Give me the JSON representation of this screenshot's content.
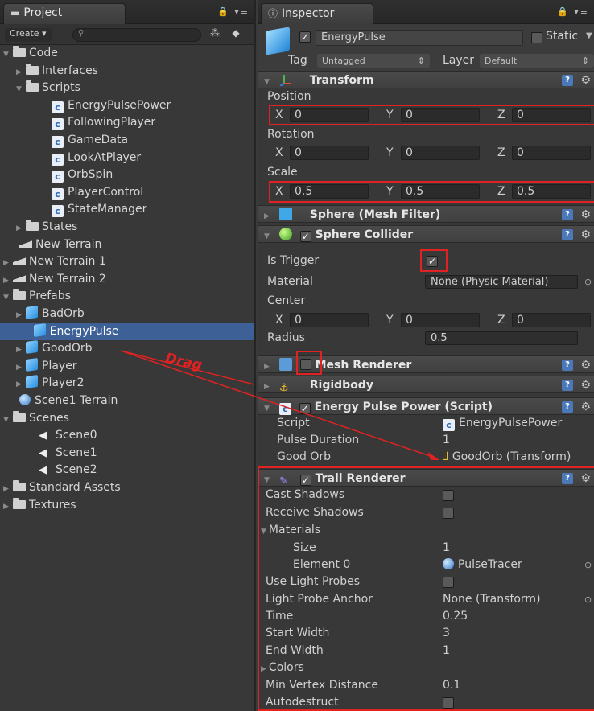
{
  "project": {
    "tab_label": "Project",
    "create_label": "Create ▾",
    "tree": [
      {
        "label": "Code",
        "icon": "folder-icon",
        "arrow": "▼",
        "indent": 0
      },
      {
        "label": "Interfaces",
        "icon": "folder-icon",
        "arrow": "▶",
        "indent": 1
      },
      {
        "label": "Scripts",
        "icon": "folder-icon",
        "arrow": "▼",
        "indent": 1
      },
      {
        "label": "EnergyPulsePower",
        "icon": "csharp-script-icon",
        "arrow": "",
        "indent": 3
      },
      {
        "label": "FollowingPlayer",
        "icon": "csharp-script-icon",
        "arrow": "",
        "indent": 3
      },
      {
        "label": "GameData",
        "icon": "csharp-script-icon",
        "arrow": "",
        "indent": 3
      },
      {
        "label": "LookAtPlayer",
        "icon": "csharp-script-icon",
        "arrow": "",
        "indent": 3
      },
      {
        "label": "OrbSpin",
        "icon": "csharp-script-icon",
        "arrow": "",
        "indent": 3
      },
      {
        "label": "PlayerControl",
        "icon": "csharp-script-icon",
        "arrow": "",
        "indent": 3
      },
      {
        "label": "StateManager",
        "icon": "csharp-script-icon",
        "arrow": "",
        "indent": 3
      },
      {
        "label": "States",
        "icon": "folder-icon",
        "arrow": "▶",
        "indent": 1
      },
      {
        "label": "New Terrain",
        "icon": "terrain-icon",
        "arrow": "",
        "indent": 0.5
      },
      {
        "label": "New Terrain 1",
        "icon": "terrain-icon",
        "arrow": "▶",
        "indent": 0
      },
      {
        "label": "New Terrain 2",
        "icon": "terrain-icon",
        "arrow": "▶",
        "indent": 0
      },
      {
        "label": "Prefabs",
        "icon": "folder-icon",
        "arrow": "▼",
        "indent": 0
      },
      {
        "label": "BadOrb",
        "icon": "prefab-cube-icon",
        "arrow": "▶",
        "indent": 1
      },
      {
        "label": "EnergyPulse",
        "icon": "prefab-cube-icon",
        "arrow": "",
        "indent": 1.6,
        "selected": true
      },
      {
        "label": "GoodOrb",
        "icon": "prefab-cube-icon",
        "arrow": "▶",
        "indent": 1
      },
      {
        "label": "Player",
        "icon": "prefab-cube-icon",
        "arrow": "▶",
        "indent": 1
      },
      {
        "label": "Player2",
        "icon": "prefab-cube-icon",
        "arrow": "▶",
        "indent": 1
      },
      {
        "label": "Scene1 Terrain",
        "icon": "terrain-sphere-icon",
        "arrow": "",
        "indent": 0.5
      },
      {
        "label": "Scenes",
        "icon": "folder-icon",
        "arrow": "▼",
        "indent": 0
      },
      {
        "label": "Scene0",
        "icon": "unity-scene-icon",
        "arrow": "",
        "indent": 2
      },
      {
        "label": "Scene1",
        "icon": "unity-scene-icon",
        "arrow": "",
        "indent": 2
      },
      {
        "label": "Scene2",
        "icon": "unity-scene-icon",
        "arrow": "",
        "indent": 2
      },
      {
        "label": "Standard Assets",
        "icon": "folder-icon",
        "arrow": "▶",
        "indent": 0
      },
      {
        "label": "Textures",
        "icon": "folder-icon",
        "arrow": "▶",
        "indent": 0
      }
    ]
  },
  "inspector": {
    "tab_label": "Inspector",
    "object_name": "EnergyPulse",
    "static_label": "Static",
    "tag_label": "Tag",
    "tag_value": "Untagged",
    "layer_label": "Layer",
    "layer_value": "Default",
    "transform": {
      "title": "Transform",
      "position_label": "Position",
      "position": {
        "x": "0",
        "y": "0",
        "z": "0"
      },
      "rotation_label": "Rotation",
      "rotation": {
        "x": "0",
        "y": "0",
        "z": "0"
      },
      "scale_label": "Scale",
      "scale": {
        "x": "0.5",
        "y": "0.5",
        "z": "0.5"
      }
    },
    "mesh_filter": {
      "title": "Sphere (Mesh Filter)"
    },
    "sphere_collider": {
      "title": "Sphere Collider",
      "is_trigger_label": "Is Trigger",
      "material_label": "Material",
      "material_value": "None (Physic Material)",
      "center_label": "Center",
      "center": {
        "x": "0",
        "y": "0",
        "z": "0"
      },
      "radius_label": "Radius",
      "radius_value": "0.5"
    },
    "mesh_renderer": {
      "title": "Mesh Renderer"
    },
    "rigidbody": {
      "title": "Rigidbody"
    },
    "energy_pulse_power": {
      "title": "Energy Pulse Power (Script)",
      "script_label": "Script",
      "script_value": "EnergyPulsePower",
      "pulse_duration_label": "Pulse Duration",
      "pulse_duration_value": "1",
      "good_orb_label": "Good Orb",
      "good_orb_value": "GoodOrb (Transform)"
    },
    "trail_renderer": {
      "title": "Trail Renderer",
      "cast_shadows_label": "Cast Shadows",
      "receive_shadows_label": "Receive Shadows",
      "materials_label": "Materials",
      "size_label": "Size",
      "size_value": "1",
      "element0_label": "Element 0",
      "element0_value": "PulseTracer",
      "use_light_probes_label": "Use Light Probes",
      "light_probe_anchor_label": "Light Probe Anchor",
      "light_probe_anchor_value": "None (Transform)",
      "time_label": "Time",
      "time_value": "0.25",
      "start_width_label": "Start Width",
      "start_width_value": "3",
      "end_width_label": "End Width",
      "end_width_value": "1",
      "colors_label": "Colors",
      "min_vertex_distance_label": "Min Vertex Distance",
      "min_vertex_distance_value": "0.1",
      "autodestruct_label": "Autodestruct"
    }
  },
  "annotation": {
    "drag_label": "Drag",
    "color": "#e02222"
  }
}
